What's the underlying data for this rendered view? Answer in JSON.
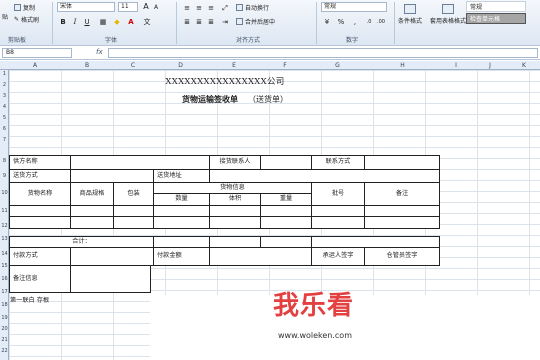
{
  "ribbon": {
    "clipboard": {
      "paste_label": "贴",
      "copy_label": "复制",
      "format_painter_label": "格式刷",
      "group_label": "剪贴板"
    },
    "font": {
      "font_name": "宋体",
      "font_size": "11",
      "grow_label": "A",
      "shrink_label": "A",
      "bold": "B",
      "italic": "I",
      "underline": "U",
      "group_label": "字体"
    },
    "alignment": {
      "wrap_label": "自动换行",
      "merge_label": "合并后居中",
      "group_label": "对齐方式"
    },
    "number": {
      "format_value": "常规",
      "percent": "%",
      "comma": ",",
      "group_label": "数字"
    },
    "styles": {
      "conditional_label": "条件格式",
      "table_format_label": "套用表格格式",
      "style_normal": "常规",
      "style_check": "检查单元格"
    },
    "accent_color": "#3c5a82"
  },
  "formula_bar": {
    "name_box": "B8",
    "fx": "fx",
    "content": ""
  },
  "sheet": {
    "columns": [
      "A",
      "B",
      "C",
      "D",
      "E",
      "F",
      "G",
      "H",
      "I",
      "J",
      "K"
    ],
    "rows": [
      "1",
      "2",
      "3",
      "4",
      "5",
      "6",
      "7",
      "8",
      "9",
      "10",
      "11",
      "12",
      "13",
      "14",
      "15",
      "16",
      "17",
      "18",
      "19",
      "20",
      "21",
      "22",
      "23",
      "24",
      "25",
      "26"
    ]
  },
  "form": {
    "title": "XXXXXXXXXXXXXXXX公司",
    "subtitle": "货物运输签收单",
    "subtitle_note": "（送货单）",
    "supplier": "供方名称",
    "receiver_contact": "接货联系人",
    "contact_method": "联系方式",
    "delivery_method": "送货方式",
    "delivery_address": "送货地址",
    "goods_name": "货物名称",
    "spec": "商品规格",
    "packing": "包装",
    "goods_info": "货物信息",
    "quantity": "数量",
    "volume": "体积",
    "weight": "重量",
    "batch_no": "批号",
    "remark": "备注",
    "total": "合计：",
    "payment_method": "付款方式",
    "payment_amount": "付款金额",
    "consignee_sign": "承运人签字",
    "warehouse_sign": "仓管员签字",
    "remark_info": "备注信息",
    "footer": "第一联白   存根"
  },
  "watermark": {
    "text": "我乐看",
    "url": "www.woleken.com"
  }
}
